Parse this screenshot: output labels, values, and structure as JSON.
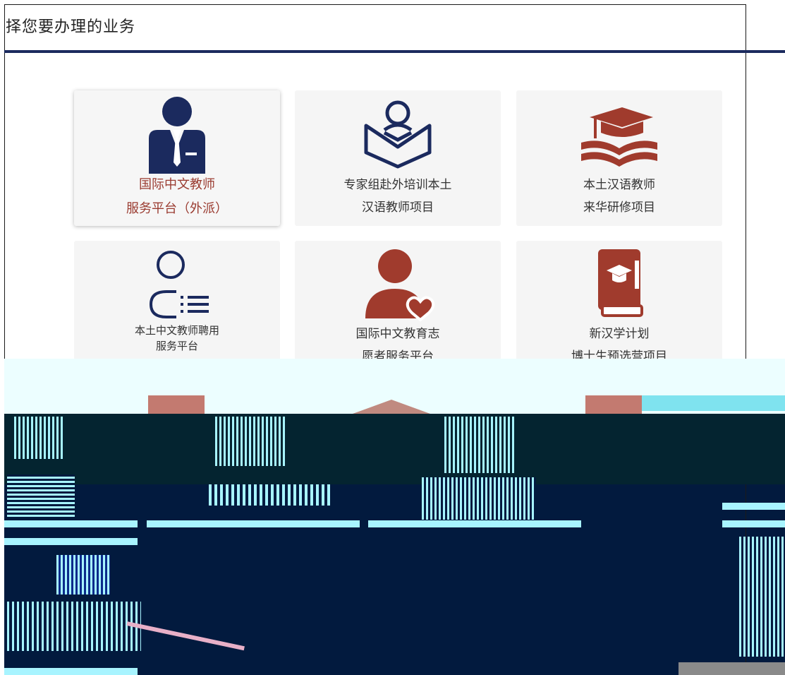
{
  "header": {
    "title": "择您要办理的业务"
  },
  "colors": {
    "navy": "#1b2a5e",
    "brick": "#a03b2d",
    "card_bg": "#f5f5f5"
  },
  "services": [
    {
      "icon": "teacher-suit-icon",
      "line1": "国际中文教师",
      "line2": "服务平台（外派）",
      "highlighted": true
    },
    {
      "icon": "person-reading-book-icon",
      "line1": "专家组赴外培训本土",
      "line2": "汉语教师项目"
    },
    {
      "icon": "graduation-cap-book-icon",
      "line1": "本土汉语教师",
      "line2": "来华研修项目"
    },
    {
      "icon": "person-list-icon",
      "line1": "本土中文教师聘用",
      "line2": "服务平台"
    },
    {
      "icon": "volunteer-heart-icon",
      "line1": "国际中文教育志",
      "line2": "愿者服务平台"
    },
    {
      "icon": "cap-book-icon",
      "line1": "新汉学计划",
      "line2": "博士生预选营项目"
    }
  ]
}
